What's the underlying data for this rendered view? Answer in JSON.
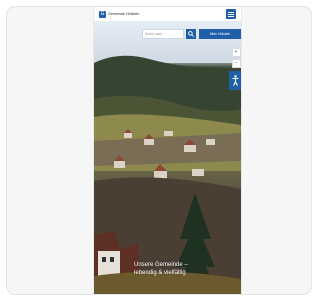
{
  "site": {
    "logo_text": "Gemeinde Hölstein"
  },
  "search": {
    "placeholder": "Suche nach..."
  },
  "cta": {
    "label": "Mein Hölstein"
  },
  "hero": {
    "headline": "Unsere Gemeinde – lebendig & vielfältig"
  },
  "icons": {
    "menu": "hamburger-menu-icon",
    "search": "search-icon",
    "zoom_in": "plus-icon",
    "zoom_out": "minus-icon",
    "accessibility": "accessibility-icon"
  },
  "colors": {
    "brand": "#1f5fa8",
    "page_bg": "#f6f6f7",
    "card_border": "#e3e4e6"
  }
}
